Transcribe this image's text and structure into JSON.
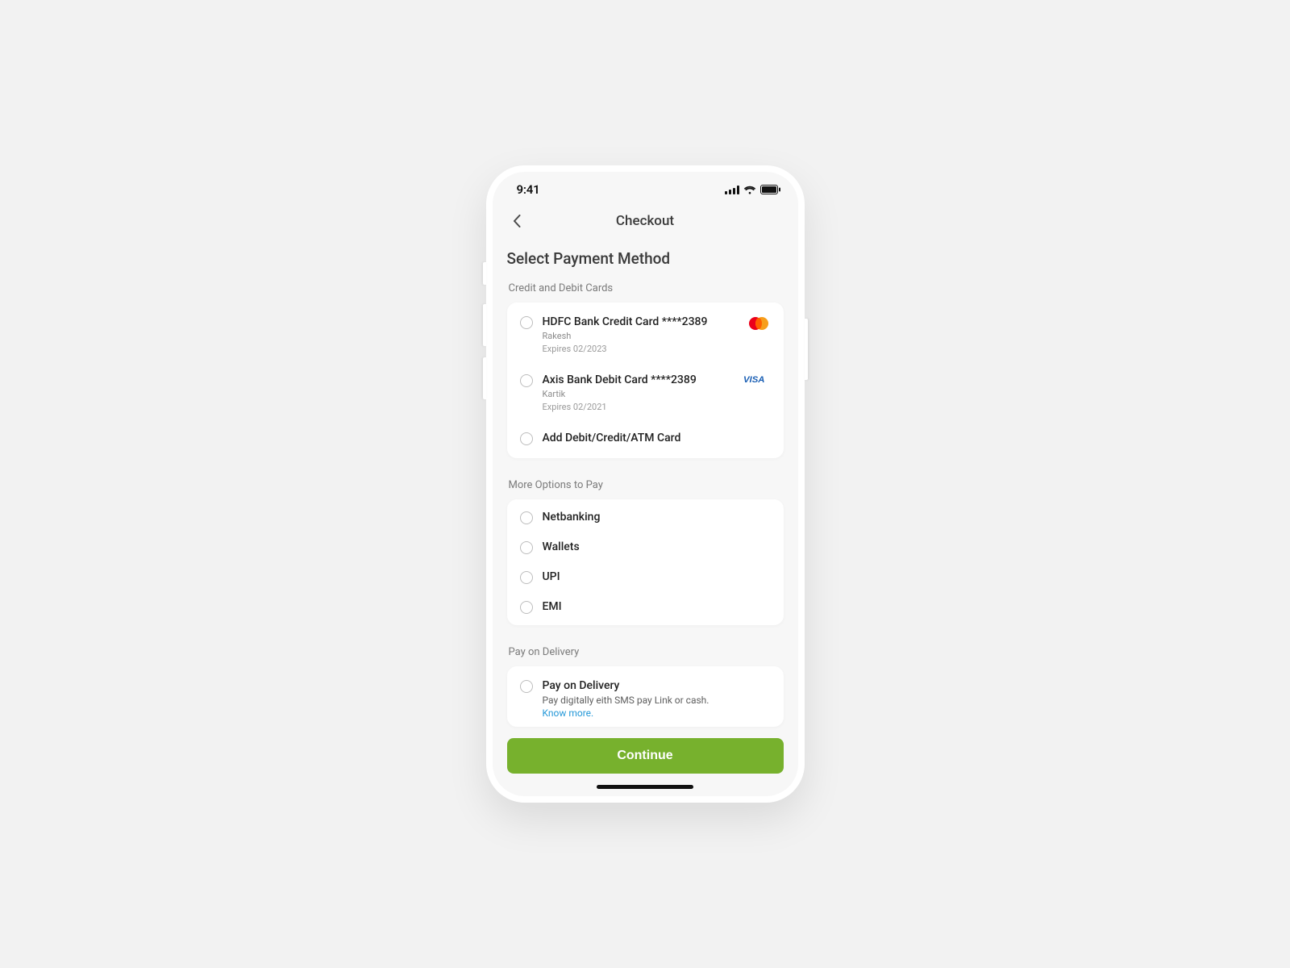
{
  "statusbar": {
    "time": "9:41"
  },
  "nav": {
    "title": "Checkout"
  },
  "page_title": "Select Payment Method",
  "sections": {
    "cards": {
      "label": "Credit and Debit Cards",
      "items": [
        {
          "title": "HDFC Bank Credit Card ****2389",
          "holder": "Rakesh",
          "expiry": "Expires 02/2023",
          "brand": "mastercard"
        },
        {
          "title": "Axis Bank Debit Card ****2389",
          "holder": "Kartik",
          "expiry": "Expires 02/2021",
          "brand": "visa"
        }
      ],
      "add_label": "Add Debit/Credit/ATM Card"
    },
    "more": {
      "label": "More Options to Pay",
      "options": [
        "Netbanking",
        "Wallets",
        "UPI",
        "EMI"
      ]
    },
    "pod": {
      "label": "Pay on Delivery",
      "title": "Pay on Delivery",
      "desc": "Pay digitally eith SMS pay Link or cash.",
      "link": "Know more."
    }
  },
  "continue_label": "Continue"
}
